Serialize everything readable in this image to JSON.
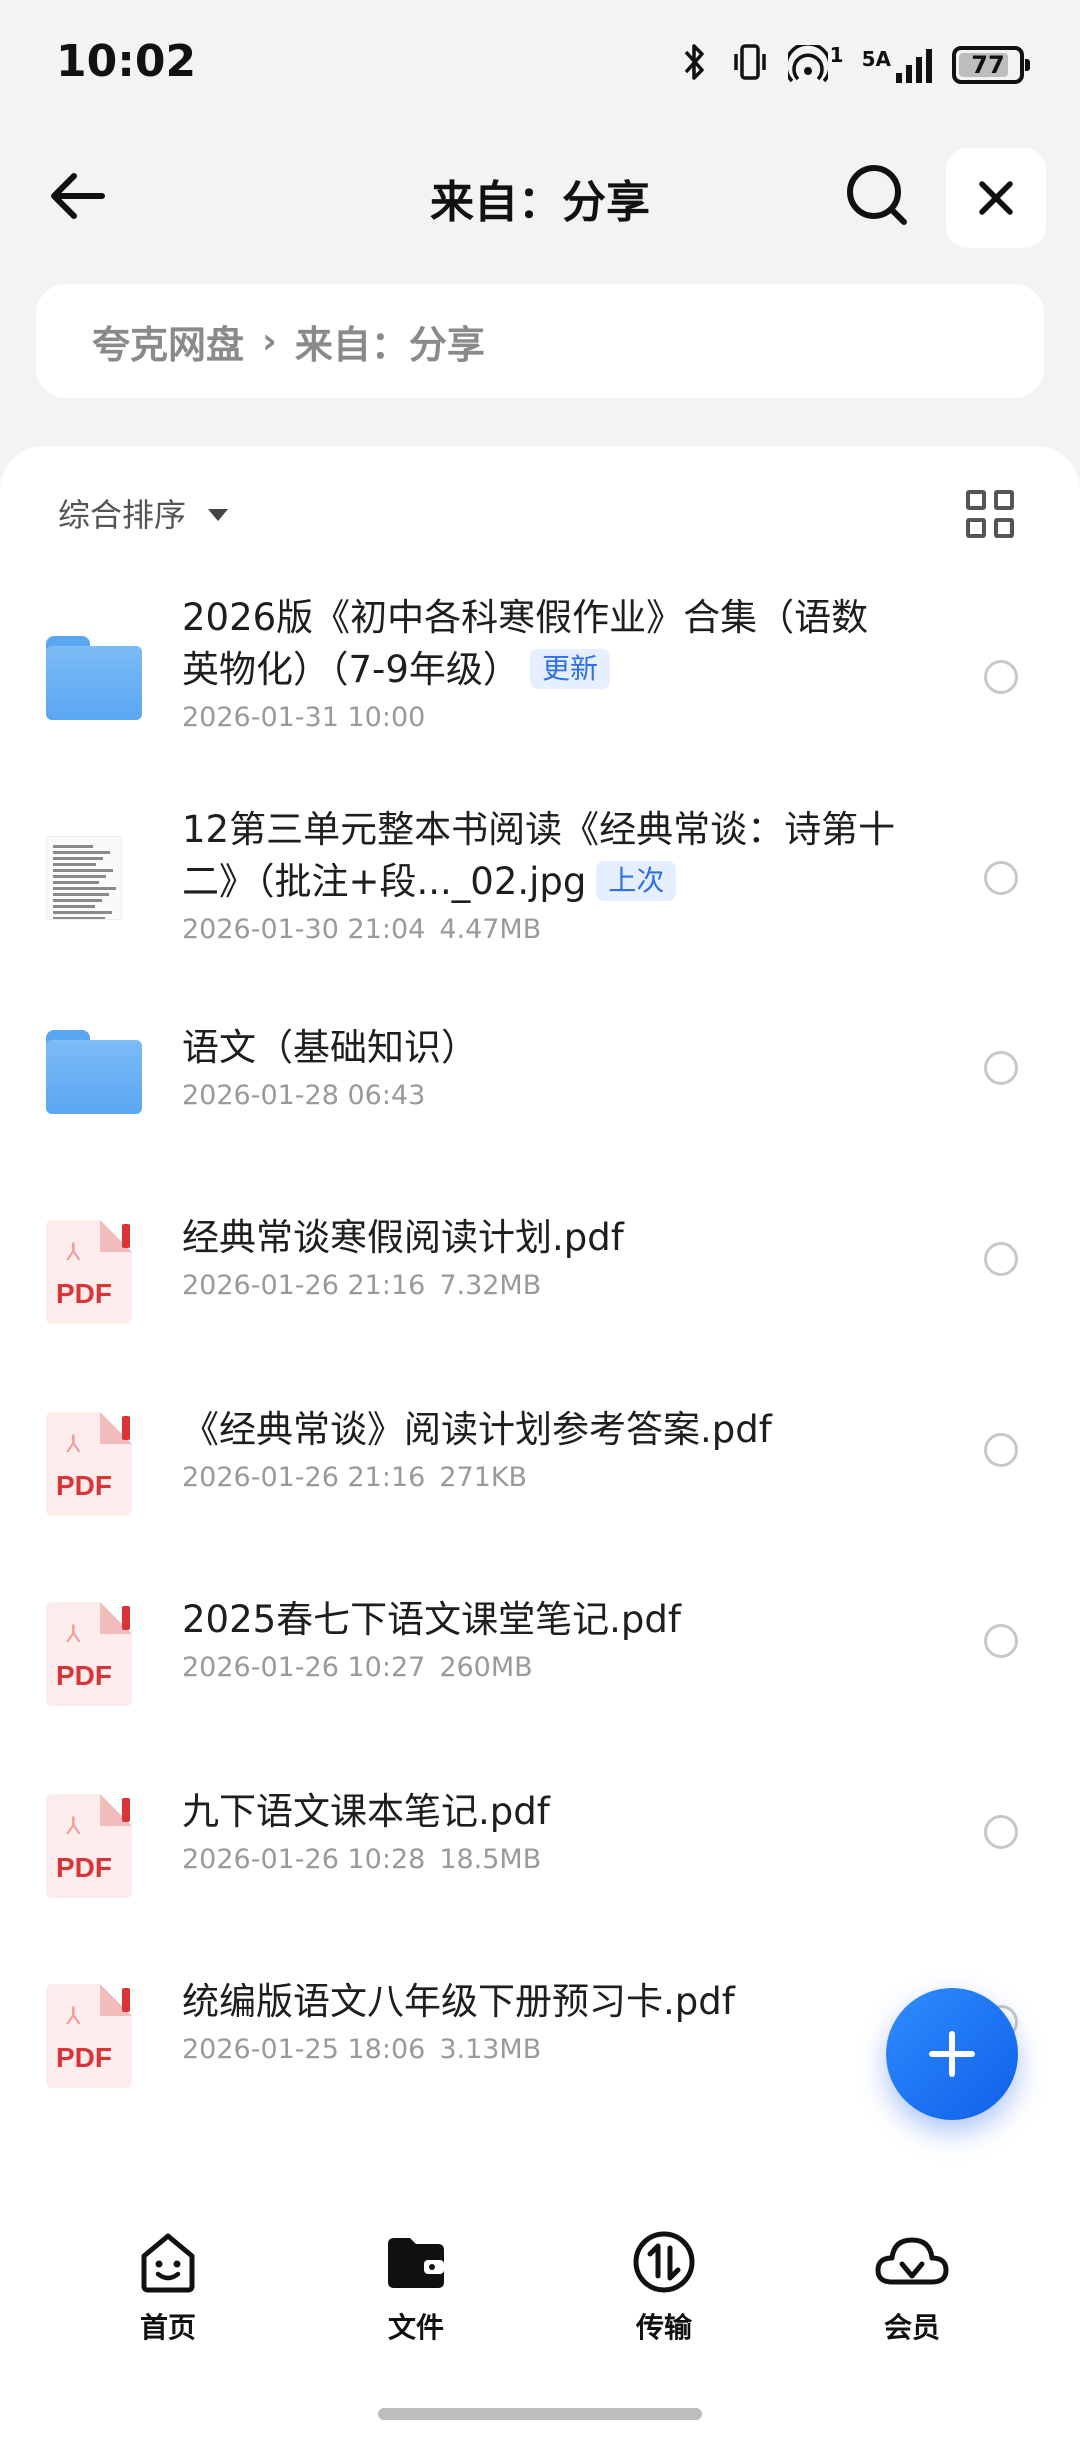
{
  "status_bar": {
    "time": "10:02",
    "icons": [
      "bluetooth-icon",
      "vibrate-icon",
      "hotspot-icon",
      "5g-signal-icon"
    ],
    "hotspot_badge": "1",
    "network": "5A",
    "battery": "77"
  },
  "header": {
    "title": "来自：分享",
    "icons": {
      "back": "back-arrow-icon",
      "search": "search-icon",
      "close": "close-icon"
    }
  },
  "breadcrumb": {
    "root": "夸克网盘",
    "separator": "›",
    "current": "来自：分享"
  },
  "toolbar": {
    "sort_label": "综合排序",
    "view_icon": "grid-view-icon"
  },
  "files": [
    {
      "type": "folder",
      "name": "2026版《初中各科寒假作业》合集（语数英物化）（7-9年级）",
      "tag": "更新",
      "date": "2026-01-31 10:00",
      "size": ""
    },
    {
      "type": "image",
      "name": "12第三单元整本书阅读《经典常谈：诗第十二》（批注+段..._02.jpg",
      "tag": "上次",
      "date": "2026-01-30 21:04",
      "size": "4.47MB"
    },
    {
      "type": "folder",
      "name": "语文（基础知识）",
      "tag": "",
      "date": "2026-01-28 06:43",
      "size": ""
    },
    {
      "type": "pdf",
      "name": "经典常谈寒假阅读计划.pdf",
      "tag": "",
      "date": "2026-01-26 21:16",
      "size": "7.32MB"
    },
    {
      "type": "pdf",
      "name": "《经典常谈》阅读计划参考答案.pdf",
      "tag": "",
      "date": "2026-01-26 21:16",
      "size": "271KB"
    },
    {
      "type": "pdf",
      "name": "2025春七下语文课堂笔记.pdf",
      "tag": "",
      "date": "2026-01-26 10:27",
      "size": "260MB"
    },
    {
      "type": "pdf",
      "name": "九下语文课本笔记.pdf",
      "tag": "",
      "date": "2026-01-26 10:28",
      "size": "18.5MB"
    },
    {
      "type": "pdf",
      "name": "统编版语文八年级下册预习卡.pdf",
      "tag": "",
      "date": "2026-01-25 18:06",
      "size": "3.13MB"
    }
  ],
  "pdf_badge": "PDF",
  "fab_icon": "plus-icon",
  "bottom_nav": [
    {
      "label": "首页",
      "icon": "home-smiley-icon",
      "active": false
    },
    {
      "label": "文件",
      "icon": "folder-wallet-icon",
      "active": true
    },
    {
      "label": "传输",
      "icon": "transfer-icon",
      "active": false
    },
    {
      "label": "会员",
      "icon": "vip-cloud-icon",
      "active": false
    }
  ],
  "colors": {
    "accent": "#1a6ff0",
    "tag_bg": "#e5efff",
    "pdf_red": "#d8343a",
    "folder_blue": "#5aa6f2"
  }
}
